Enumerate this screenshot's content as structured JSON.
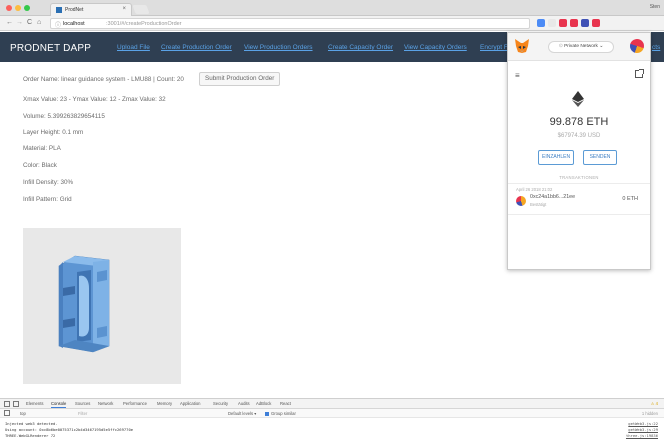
{
  "browser": {
    "tab_title": "ProdNet",
    "tab_close": "×",
    "profile_name": "Sten",
    "url_host": "localhost",
    "url_path": ":3001/#/createProductionOrder",
    "back": "←",
    "forward": "→",
    "reload": "C",
    "home": "⌂",
    "lock": "ⓘ",
    "extension_colors": [
      "#4c8bf5",
      "#e8e8e8",
      "#e8344e",
      "#e8344e",
      "#3f51b5",
      "#e8344e"
    ]
  },
  "navbar": {
    "brand": "PRODNET DAPP",
    "links": [
      "Upload File",
      "Create Production Order",
      "View Production Orders",
      "Create Capacity Order",
      "View Capacity Orders",
      "Encrypt F",
      "cts"
    ]
  },
  "order": {
    "name_line": "Order Name: linear guidance system - LMU88 | Count: 20",
    "submit_button": "Submit Production Order",
    "dimensions": "Xmax Value: 23 - Ymax Value: 12 - Zmax Value: 32",
    "volume": "Volume: 5.399263829654115",
    "layer_height": "Layer Height: 0.1 mm",
    "material": "Material: PLA",
    "color": "Color: Black",
    "infill_density": "Infill Density: 30%",
    "infill_pattern": "Infill Pattern: Grid"
  },
  "metamask": {
    "network": "Private Network",
    "network_chevron": "⌄",
    "balance": "99.878 ETH",
    "usd": "$67974.39 USD",
    "deposit_button": "EINZAHLEN",
    "send_button": "SENDEN",
    "transactions_title": "TRANSAKTIONEN",
    "menu_icon": "≡",
    "transaction": {
      "date": "April 26 2018 21:02",
      "address": "0xc24a1bb6...21ee",
      "status": "Bestätigt",
      "amount": "0 ETH"
    }
  },
  "devtools": {
    "tabs": [
      "Elements",
      "Console",
      "Sources",
      "Network",
      "Performance",
      "Memory",
      "Application",
      "Security",
      "Audits",
      "AdBlock",
      "React"
    ],
    "active_tab": "Console",
    "context": "top",
    "filter_placeholder": "Filter",
    "default_levels": "Default levels ▾",
    "group_similar": "Group similar",
    "hidden_count": "1 hidden",
    "warnings": "⚠ 4",
    "console_lines": [
      {
        "text": "Injected web3 detected.",
        "source": "getWeb3.js:22"
      },
      {
        "text": "Using account: 0xc8b6be0075371c2b4d3467195d5e5ffc269770e",
        "source": "getWeb3.js:29"
      },
      {
        "text": "THREE.WebGLRenderer 72",
        "source": "three.js:19836"
      }
    ]
  },
  "colors": {
    "navbar_bg": "#2f3f52",
    "nav_link": "#5aa2e6",
    "part_color": "#6ea6e0"
  }
}
